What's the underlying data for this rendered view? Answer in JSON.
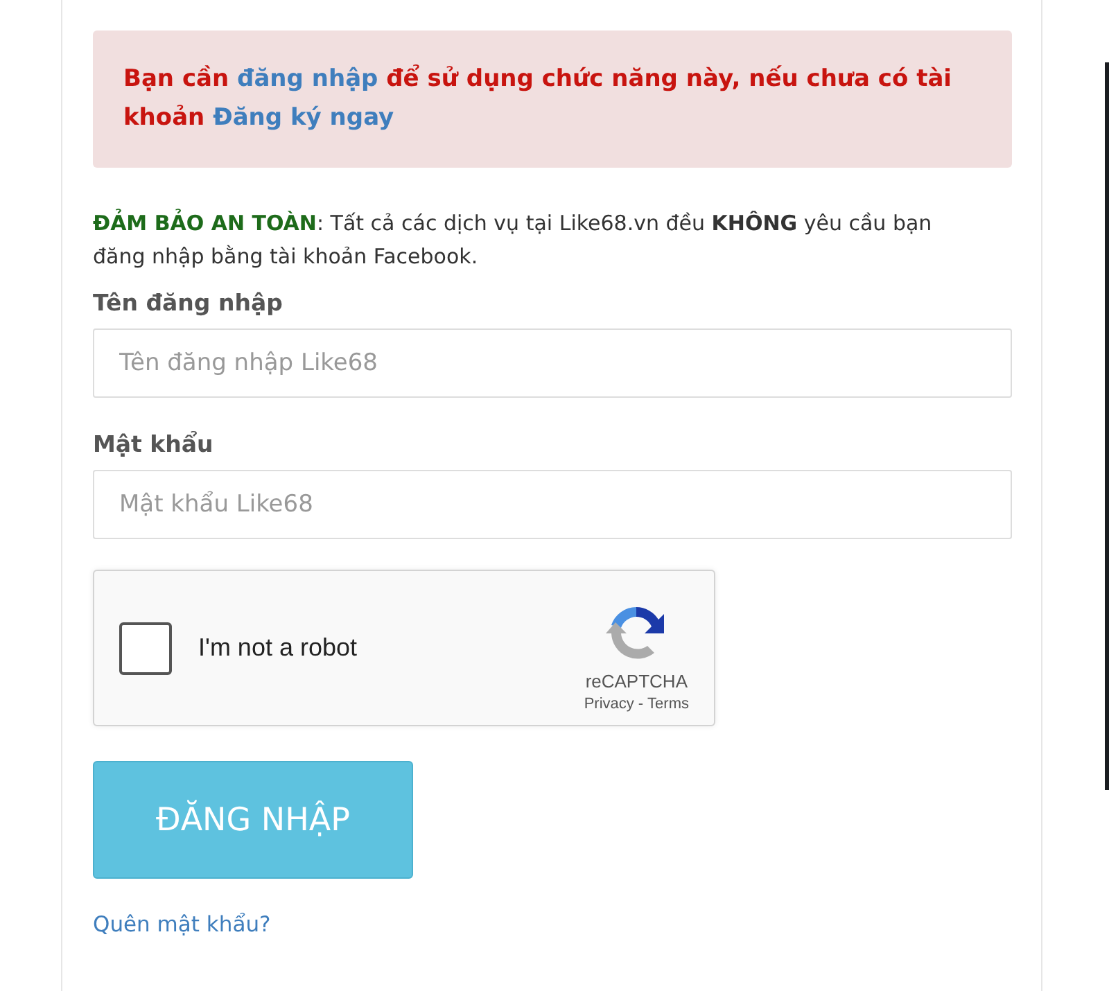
{
  "alert": {
    "parts": [
      {
        "kind": "text",
        "text": "Bạn cần "
      },
      {
        "kind": "link",
        "text": "đăng nhập"
      },
      {
        "kind": "text",
        "text": " để sử dụng chức năng này, nếu chưa có tài khoản "
      },
      {
        "kind": "link",
        "text": "Đăng ký ngay"
      }
    ]
  },
  "notice": {
    "parts": [
      {
        "kind": "highlight",
        "text": "ĐẢM BẢO AN TOÀN"
      },
      {
        "kind": "text",
        "text": ": Tất cả các dịch vụ tại Like68.vn đều "
      },
      {
        "kind": "strong",
        "text": "KHÔNG"
      },
      {
        "kind": "text",
        "text": " yêu cầu bạn đăng nhập bằng tài khoản Facebook."
      }
    ]
  },
  "fields": [
    {
      "label": "Tên đăng nhập",
      "placeholder": "Tên đăng nhập Like68"
    },
    {
      "label": "Mật khẩu",
      "placeholder": "Mật khẩu Like68"
    }
  ],
  "captcha": {
    "label": "I'm not a robot",
    "checked": false,
    "brand": "reCAPTCHA",
    "privacy": "Privacy",
    "separator": "-",
    "terms": "Terms"
  },
  "submit": "ĐĂNG NHẬP",
  "forgot": "Quên mật khẩu?"
}
